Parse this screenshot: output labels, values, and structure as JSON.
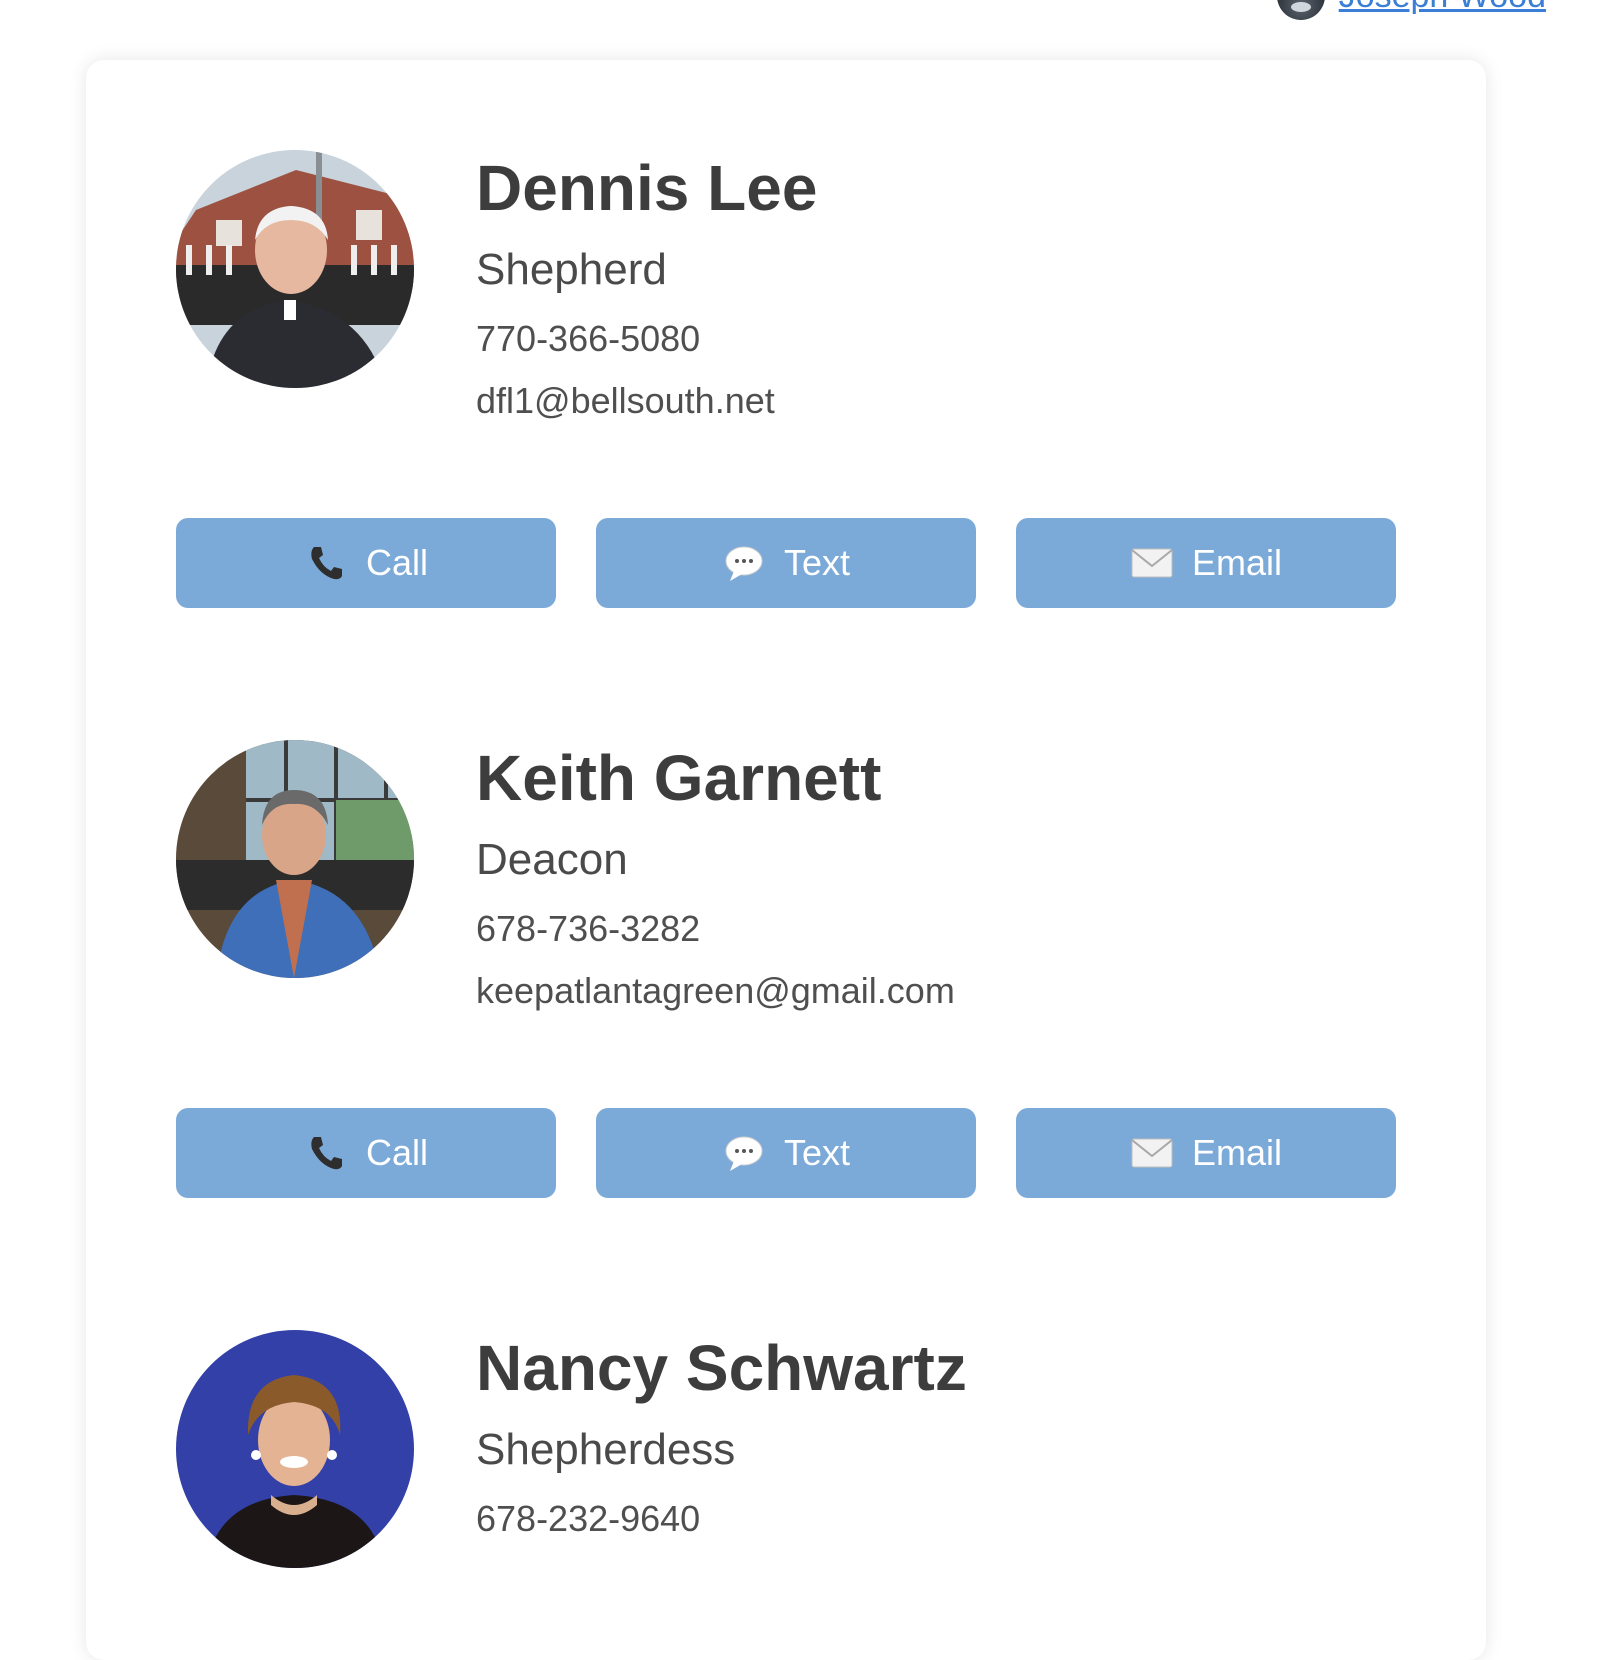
{
  "header": {
    "user_name": "Joseph Wood"
  },
  "contacts": [
    {
      "name": "Dennis Lee",
      "role": "Shepherd",
      "phone": "770-366-5080",
      "email": "dfl1@bellsouth.net",
      "avatar": "photo-older-man-outdoors"
    },
    {
      "name": "Keith Garnett",
      "role": "Deacon",
      "phone": "678-736-3282",
      "email": "keepatlantagreen@gmail.com",
      "avatar": "photo-man-blue-blazer"
    },
    {
      "name": "Nancy Schwartz",
      "role": "Shepherdess",
      "phone": "678-232-9640",
      "email": "",
      "avatar": "photo-woman-blue-background"
    }
  ],
  "actions": {
    "call_label": "Call",
    "text_label": "Text",
    "email_label": "Email",
    "call_icon": "phone-icon",
    "text_icon": "speech-bubble-icon",
    "email_icon": "envelope-icon"
  },
  "colors": {
    "button_bg": "#7caad8",
    "link": "#3a7fd5",
    "text": "#444444"
  }
}
